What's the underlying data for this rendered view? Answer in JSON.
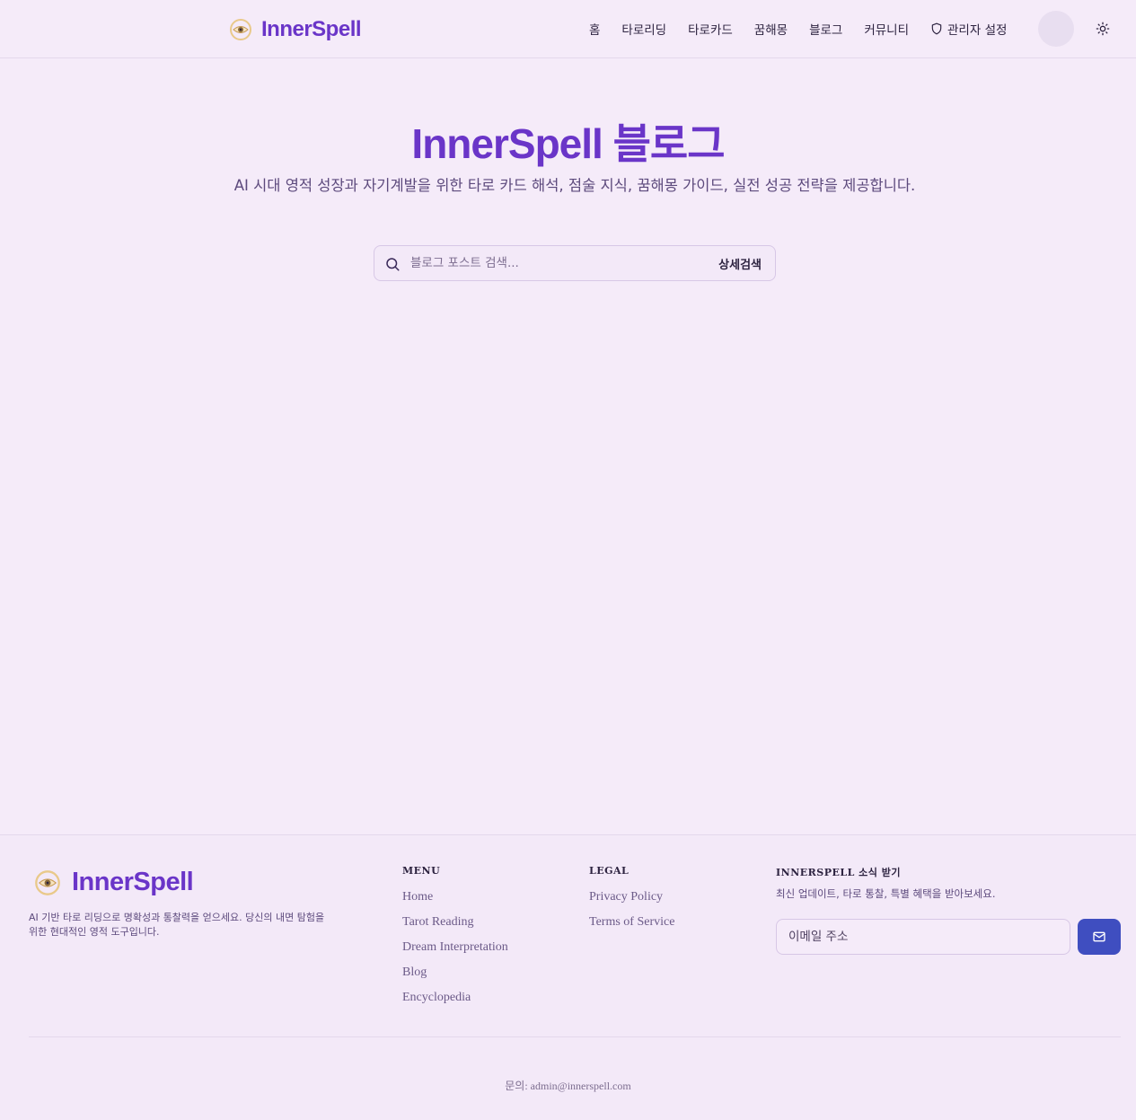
{
  "header": {
    "logo_text": "InnerSpell",
    "nav": [
      {
        "label": "홈"
      },
      {
        "label": "타로리딩"
      },
      {
        "label": "타로카드"
      },
      {
        "label": "꿈해몽"
      },
      {
        "label": "블로그"
      },
      {
        "label": "커뮤니티"
      },
      {
        "label": "관리자 설정",
        "icon": "shield-icon"
      }
    ],
    "theme_icon": "sun-icon"
  },
  "hero": {
    "title": "InnerSpell 블로그",
    "subtitle": "AI 시대 영적 성장과 자기계발을 위한 타로 카드 해석, 점술 지식, 꿈해몽 가이드, 실전 성공 전략을 제공합니다.",
    "search_placeholder": "블로그 포스트 검색...",
    "search_value": "",
    "advanced_search": "상세검색"
  },
  "footer": {
    "logo_text": "InnerSpell",
    "description": "AI 기반 타로 리딩으로 명확성과 통찰력을 얻으세요. 당신의 내면 탐험을 위한 현대적인 영적 도구입니다.",
    "menu": {
      "title": "MENU",
      "links": [
        "Home",
        "Tarot Reading",
        "Dream Interpretation",
        "Blog",
        "Encyclopedia"
      ]
    },
    "legal": {
      "title": "LEGAL",
      "links": [
        "Privacy Policy",
        "Terms of Service"
      ]
    },
    "newsletter": {
      "title": "INNERSPELL 소식 받기",
      "description": "최신 업데이트, 타로 통찰, 특별 혜택을 받아보세요.",
      "email_placeholder": "이메일 주소",
      "submit_icon": "mail-icon"
    },
    "contact": "문의: admin@innerspell.com"
  },
  "colors": {
    "background": "#f5ebf9",
    "brand": "#6a35c8",
    "button": "#3f4ec0"
  }
}
